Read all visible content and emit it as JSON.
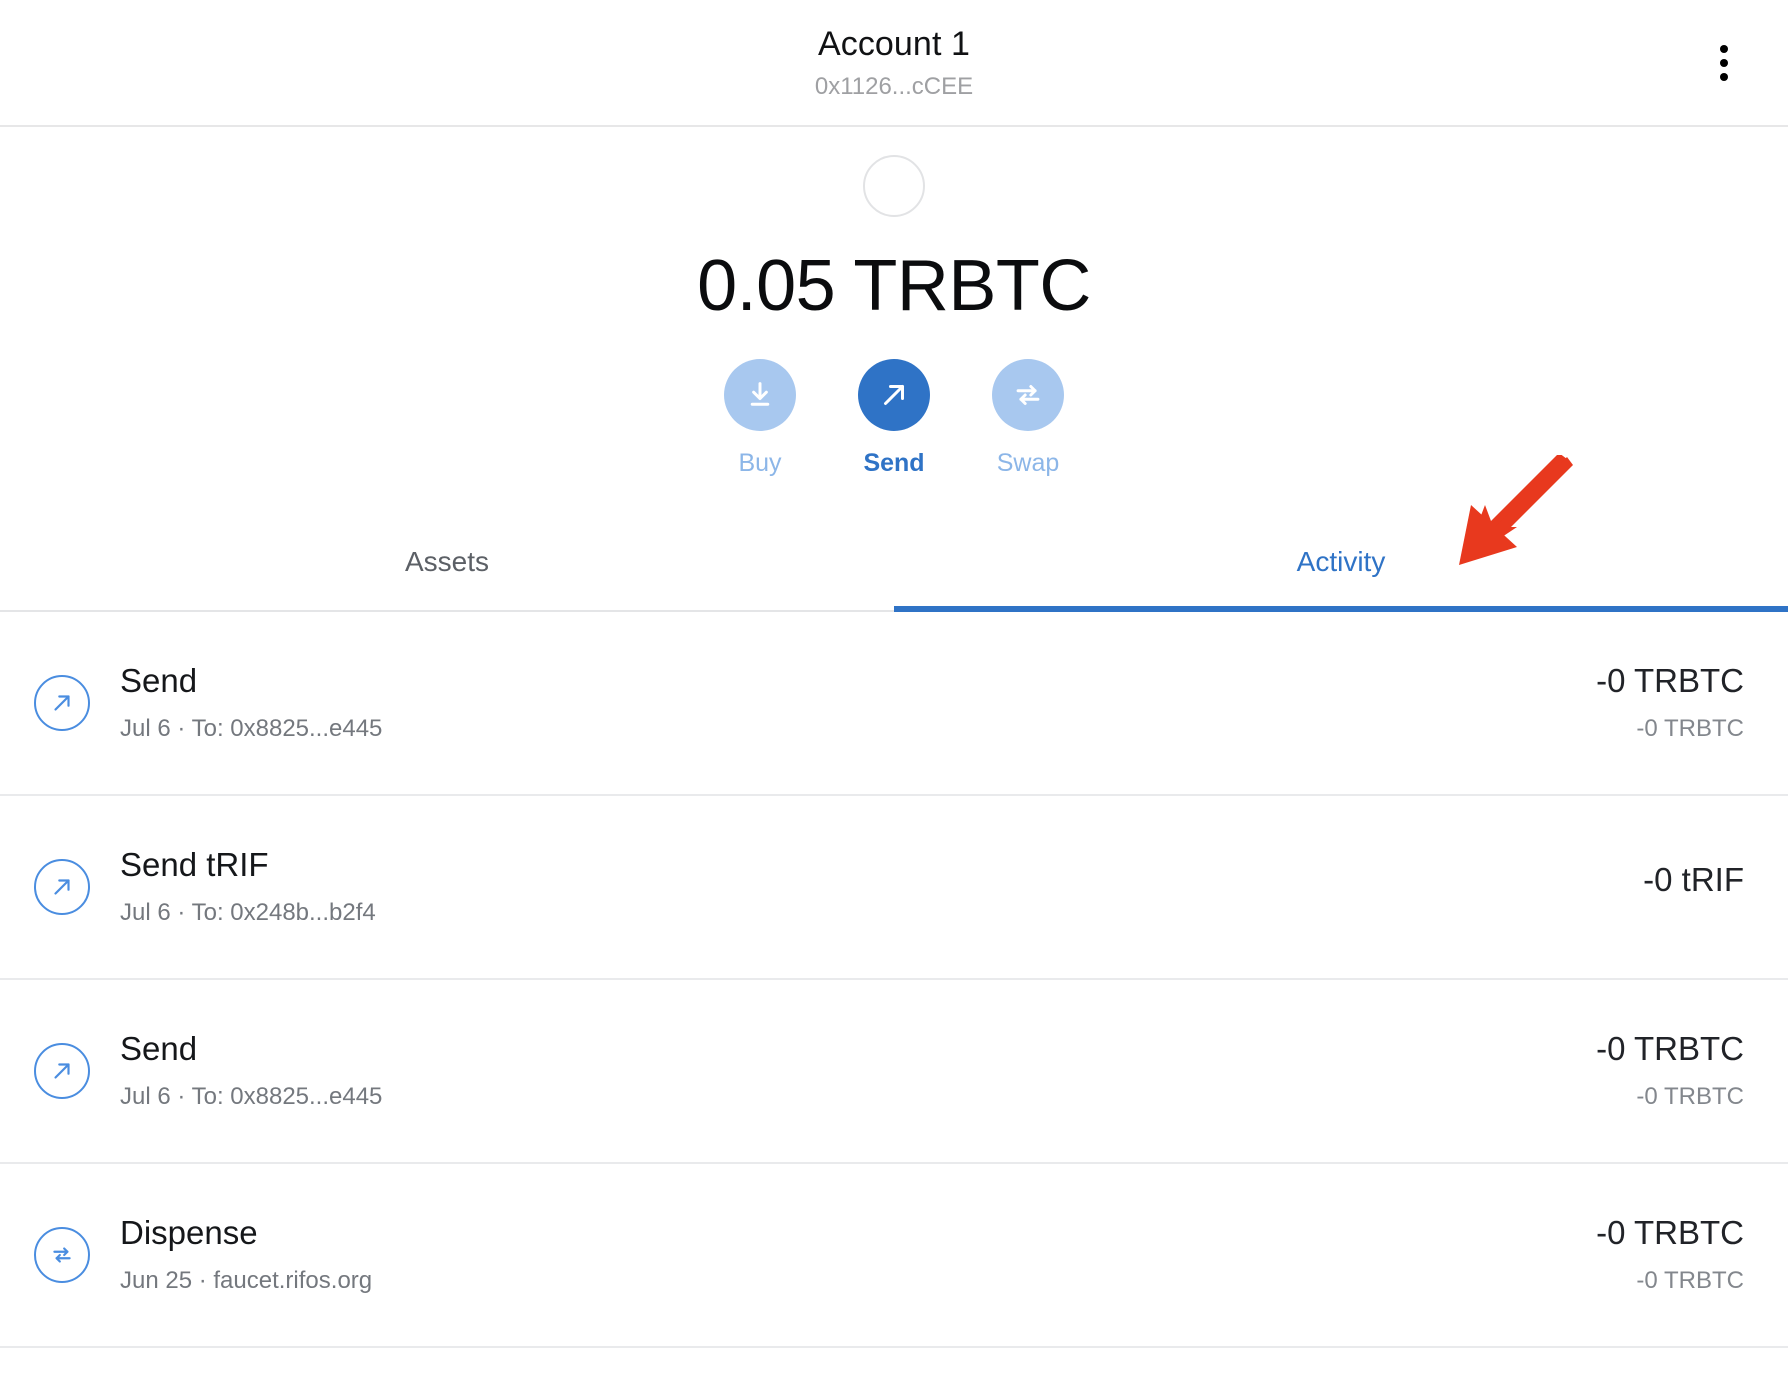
{
  "header": {
    "account_name": "Account 1",
    "account_address": "0x1126...cCEE",
    "menu_icon": "kebab-menu-icon"
  },
  "balance": {
    "avatar_icon": "token-avatar-placeholder",
    "amount": "0.05 TRBTC"
  },
  "actions": [
    {
      "label": "Buy",
      "icon": "download-arrow-icon",
      "state": "muted"
    },
    {
      "label": "Send",
      "icon": "arrow-up-right-icon",
      "state": "primary"
    },
    {
      "label": "Swap",
      "icon": "swap-arrows-icon",
      "state": "muted"
    }
  ],
  "tabs": [
    {
      "label": "Assets",
      "active": false
    },
    {
      "label": "Activity",
      "active": true
    }
  ],
  "activity": [
    {
      "icon": "arrow-up-right-icon",
      "title": "Send",
      "subtitle": "Jul 6 · To: 0x8825...e445",
      "amount_primary": "-0 TRBTC",
      "amount_secondary": "-0 TRBTC"
    },
    {
      "icon": "arrow-up-right-icon",
      "title": "Send tRIF",
      "subtitle": "Jul 6 · To: 0x248b...b2f4",
      "amount_primary": "-0 tRIF",
      "amount_secondary": ""
    },
    {
      "icon": "arrow-up-right-icon",
      "title": "Send",
      "subtitle": "Jul 6 · To: 0x8825...e445",
      "amount_primary": "-0 TRBTC",
      "amount_secondary": "-0 TRBTC"
    },
    {
      "icon": "swap-arrows-icon",
      "title": "Dispense",
      "subtitle": "Jun 25 · faucet.rifos.org",
      "amount_primary": "-0 TRBTC",
      "amount_secondary": "-0 TRBTC"
    }
  ],
  "annotation": {
    "icon": "red-arrow-pointing-down-left",
    "color": "#E8391E"
  },
  "colors": {
    "accent_blue": "#2f73c6",
    "muted_blue": "#a8c8ef",
    "annotation_red": "#E8391E",
    "divider": "#e9eaec"
  }
}
